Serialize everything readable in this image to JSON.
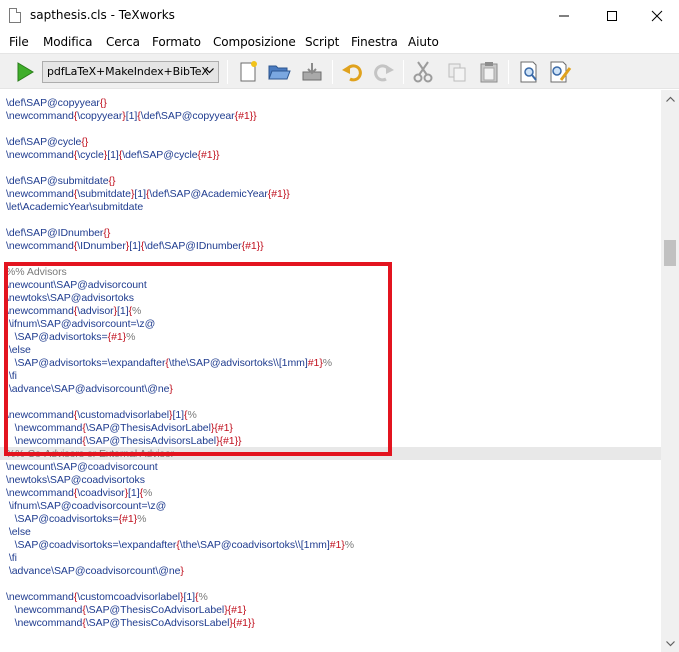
{
  "window": {
    "title": "sapthesis.cls - TeXworks"
  },
  "menu": [
    "File",
    "Modifica",
    "Cerca",
    "Formato",
    "Composizione",
    "Script",
    "Finestra",
    "Aiuto"
  ],
  "toolbar": {
    "engine": "pdfLaTeX+MakeIndex+BibTeX",
    "icons": [
      "typeset-icon",
      "new-document-icon",
      "open-folder-icon",
      "save-icon",
      "undo-icon",
      "redo-icon",
      "cut-icon",
      "copy-icon",
      "paste-icon",
      "find-icon",
      "replace-icon"
    ]
  },
  "editor": {
    "lines": [
      [
        [
          "cmd",
          "\\def\\SAP@copyyear"
        ],
        [
          "br",
          "{}"
        ]
      ],
      [
        [
          "cmd",
          "\\newcommand"
        ],
        [
          "br",
          "{"
        ],
        [
          "cmd",
          "\\copyyear"
        ],
        [
          "br",
          "}"
        ],
        [
          "txt",
          "[1]"
        ],
        [
          "br",
          "{"
        ],
        [
          "cmd",
          "\\def\\SAP@copyyear"
        ],
        [
          "br",
          "{#1}}"
        ]
      ],
      [],
      [
        [
          "cmd",
          "\\def\\SAP@cycle"
        ],
        [
          "br",
          "{}"
        ]
      ],
      [
        [
          "cmd",
          "\\newcommand"
        ],
        [
          "br",
          "{"
        ],
        [
          "cmd",
          "\\cycle"
        ],
        [
          "br",
          "}"
        ],
        [
          "txt",
          "[1]"
        ],
        [
          "br",
          "{"
        ],
        [
          "cmd",
          "\\def\\SAP@cycle"
        ],
        [
          "br",
          "{#1}}"
        ]
      ],
      [],
      [
        [
          "cmd",
          "\\def\\SAP@submitdate"
        ],
        [
          "br",
          "{}"
        ]
      ],
      [
        [
          "cmd",
          "\\newcommand"
        ],
        [
          "br",
          "{"
        ],
        [
          "cmd",
          "\\submitdate"
        ],
        [
          "br",
          "}"
        ],
        [
          "txt",
          "[1]"
        ],
        [
          "br",
          "{"
        ],
        [
          "cmd",
          "\\def\\SAP@AcademicYear"
        ],
        [
          "br",
          "{#1}}"
        ]
      ],
      [
        [
          "cmd",
          "\\let\\AcademicYear\\submitdate"
        ]
      ],
      [],
      [
        [
          "cmd",
          "\\def\\SAP@IDnumber"
        ],
        [
          "br",
          "{}"
        ]
      ],
      [
        [
          "cmd",
          "\\newcommand"
        ],
        [
          "br",
          "{"
        ],
        [
          "cmd",
          "\\IDnumber"
        ],
        [
          "br",
          "}"
        ],
        [
          "txt",
          "[1]"
        ],
        [
          "br",
          "{"
        ],
        [
          "cmd",
          "\\def\\SAP@IDnumber"
        ],
        [
          "br",
          "{#1}}"
        ]
      ],
      [],
      [
        [
          "cmt",
          "%% Advisors"
        ]
      ],
      [
        [
          "cmd",
          "\\newcount\\SAP@advisorcount"
        ]
      ],
      [
        [
          "cmd",
          "\\newtoks\\SAP@advisortoks"
        ]
      ],
      [
        [
          "cmd",
          "\\newcommand"
        ],
        [
          "br",
          "{"
        ],
        [
          "cmd",
          "\\advisor"
        ],
        [
          "br",
          "}"
        ],
        [
          "txt",
          "[1]"
        ],
        [
          "br",
          "{"
        ],
        [
          "cmt",
          "%"
        ]
      ],
      [
        [
          "txt",
          " "
        ],
        [
          "cmd",
          "\\ifnum\\SAP@advisorcount"
        ],
        [
          "txt",
          "="
        ],
        [
          "cmd",
          "\\z@"
        ]
      ],
      [
        [
          "txt",
          "   "
        ],
        [
          "cmd",
          "\\SAP@advisortoks"
        ],
        [
          "txt",
          "="
        ],
        [
          "br",
          "{#1}"
        ],
        [
          "cmt",
          "%"
        ]
      ],
      [
        [
          "txt",
          " "
        ],
        [
          "cmd",
          "\\else"
        ]
      ],
      [
        [
          "txt",
          "   "
        ],
        [
          "cmd",
          "\\SAP@advisortoks"
        ],
        [
          "txt",
          "="
        ],
        [
          "cmd",
          "\\expandafter"
        ],
        [
          "br",
          "{"
        ],
        [
          "cmd",
          "\\the\\SAP@advisortoks\\\\"
        ],
        [
          "txt",
          "[1mm]"
        ],
        [
          "br",
          "#1}"
        ],
        [
          "cmt",
          "%"
        ]
      ],
      [
        [
          "txt",
          " "
        ],
        [
          "cmd",
          "\\fi"
        ]
      ],
      [
        [
          "txt",
          " "
        ],
        [
          "cmd",
          "\\advance\\SAP@advisorcount\\@ne"
        ],
        [
          "br",
          "}"
        ]
      ],
      [],
      [
        [
          "cmd",
          "\\newcommand"
        ],
        [
          "br",
          "{"
        ],
        [
          "cmd",
          "\\customadvisorlabel"
        ],
        [
          "br",
          "}"
        ],
        [
          "txt",
          "[1]"
        ],
        [
          "br",
          "{"
        ],
        [
          "cmt",
          "%"
        ]
      ],
      [
        [
          "txt",
          "   "
        ],
        [
          "cmd",
          "\\newcommand"
        ],
        [
          "br",
          "{"
        ],
        [
          "cmd",
          "\\SAP@ThesisAdvisorLabel"
        ],
        [
          "br",
          "}{#1}"
        ]
      ],
      [
        [
          "txt",
          "   "
        ],
        [
          "cmd",
          "\\newcommand"
        ],
        [
          "br",
          "{"
        ],
        [
          "cmd",
          "\\SAP@ThesisAdvisorsLabel"
        ],
        [
          "br",
          "}{#1}}"
        ]
      ],
      [
        [
          "cmt",
          "%% Co-Advisors or External Advisor"
        ]
      ],
      [
        [
          "cmd",
          "\\newcount\\SAP@coadvisorcount"
        ]
      ],
      [
        [
          "cmd",
          "\\newtoks\\SAP@coadvisortoks"
        ]
      ],
      [
        [
          "cmd",
          "\\newcommand"
        ],
        [
          "br",
          "{"
        ],
        [
          "cmd",
          "\\coadvisor"
        ],
        [
          "br",
          "}"
        ],
        [
          "txt",
          "[1]"
        ],
        [
          "br",
          "{"
        ],
        [
          "cmt",
          "%"
        ]
      ],
      [
        [
          "txt",
          " "
        ],
        [
          "cmd",
          "\\ifnum\\SAP@coadvisorcount"
        ],
        [
          "txt",
          "="
        ],
        [
          "cmd",
          "\\z@"
        ]
      ],
      [
        [
          "txt",
          "   "
        ],
        [
          "cmd",
          "\\SAP@coadvisortoks"
        ],
        [
          "txt",
          "="
        ],
        [
          "br",
          "{#1}"
        ],
        [
          "cmt",
          "%"
        ]
      ],
      [
        [
          "txt",
          " "
        ],
        [
          "cmd",
          "\\else"
        ]
      ],
      [
        [
          "txt",
          "   "
        ],
        [
          "cmd",
          "\\SAP@coadvisortoks"
        ],
        [
          "txt",
          "="
        ],
        [
          "cmd",
          "\\expandafter"
        ],
        [
          "br",
          "{"
        ],
        [
          "cmd",
          "\\the\\SAP@coadvisortoks\\\\"
        ],
        [
          "txt",
          "[1mm]"
        ],
        [
          "br",
          "#1}"
        ],
        [
          "cmt",
          "%"
        ]
      ],
      [
        [
          "txt",
          " "
        ],
        [
          "cmd",
          "\\fi"
        ]
      ],
      [
        [
          "txt",
          " "
        ],
        [
          "cmd",
          "\\advance\\SAP@coadvisorcount\\@ne"
        ],
        [
          "br",
          "}"
        ]
      ],
      [],
      [
        [
          "cmd",
          "\\newcommand"
        ],
        [
          "br",
          "{"
        ],
        [
          "cmd",
          "\\customcoadvisorlabel"
        ],
        [
          "br",
          "}"
        ],
        [
          "txt",
          "[1]"
        ],
        [
          "br",
          "{"
        ],
        [
          "cmt",
          "%"
        ]
      ],
      [
        [
          "txt",
          "   "
        ],
        [
          "cmd",
          "\\newcommand"
        ],
        [
          "br",
          "{"
        ],
        [
          "cmd",
          "\\SAP@ThesisCoAdvisorLabel"
        ],
        [
          "br",
          "}{#1}"
        ]
      ],
      [
        [
          "txt",
          "   "
        ],
        [
          "cmd",
          "\\newcommand"
        ],
        [
          "br",
          "{"
        ],
        [
          "cmd",
          "\\SAP@ThesisCoAdvisorsLabel"
        ],
        [
          "br",
          "}{#1}}"
        ]
      ]
    ]
  },
  "colors": {
    "command": "#1f3c8f",
    "brace": "#c0111f",
    "comment": "#7a7a7a",
    "annotation_box": "#e3141f"
  }
}
